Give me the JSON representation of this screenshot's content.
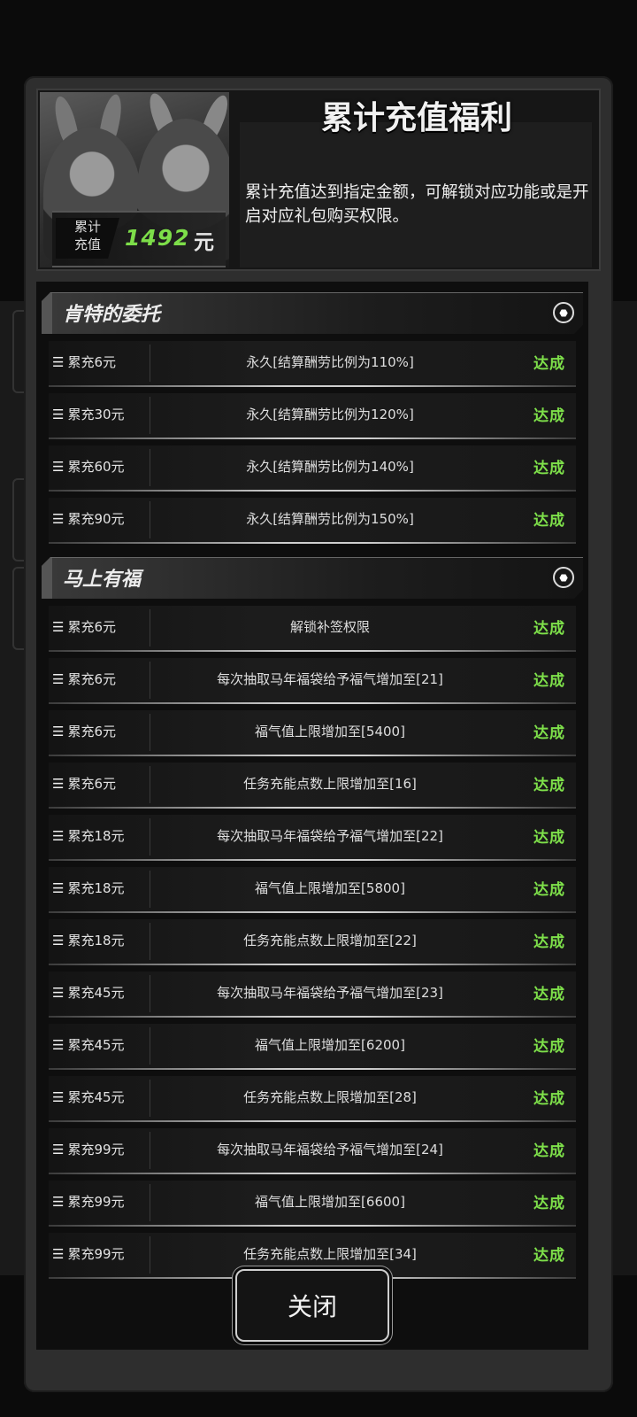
{
  "header": {
    "title": "累计充值福利",
    "description": "累计充值达到指定金额，可解锁对应功能或是开启对应礼包购买权限。",
    "total_label_line1": "累计",
    "total_label_line2": "充值",
    "total_value": "1492",
    "total_unit": "元"
  },
  "sections": [
    {
      "title": "肯特的委托",
      "rows": [
        {
          "req": "累充6元",
          "reward": "永久[结算酬劳比例为110%]",
          "status": "达成"
        },
        {
          "req": "累充30元",
          "reward": "永久[结算酬劳比例为120%]",
          "status": "达成"
        },
        {
          "req": "累充60元",
          "reward": "永久[结算酬劳比例为140%]",
          "status": "达成"
        },
        {
          "req": "累充90元",
          "reward": "永久[结算酬劳比例为150%]",
          "status": "达成"
        }
      ]
    },
    {
      "title": "马上有福",
      "rows": [
        {
          "req": "累充6元",
          "reward": "解锁补签权限",
          "status": "达成"
        },
        {
          "req": "累充6元",
          "reward": "每次抽取马年福袋给予福气增加至[21]",
          "status": "达成"
        },
        {
          "req": "累充6元",
          "reward": "福气值上限增加至[5400]",
          "status": "达成"
        },
        {
          "req": "累充6元",
          "reward": "任务充能点数上限增加至[16]",
          "status": "达成"
        },
        {
          "req": "累充18元",
          "reward": "每次抽取马年福袋给予福气增加至[22]",
          "status": "达成"
        },
        {
          "req": "累充18元",
          "reward": "福气值上限增加至[5800]",
          "status": "达成"
        },
        {
          "req": "累充18元",
          "reward": "任务充能点数上限增加至[22]",
          "status": "达成"
        },
        {
          "req": "累充45元",
          "reward": "每次抽取马年福袋给予福气增加至[23]",
          "status": "达成"
        },
        {
          "req": "累充45元",
          "reward": "福气值上限增加至[6200]",
          "status": "达成"
        },
        {
          "req": "累充45元",
          "reward": "任务充能点数上限增加至[28]",
          "status": "达成"
        },
        {
          "req": "累充99元",
          "reward": "每次抽取马年福袋给予福气增加至[24]",
          "status": "达成"
        },
        {
          "req": "累充99元",
          "reward": "福气值上限增加至[6600]",
          "status": "达成"
        },
        {
          "req": "累充99元",
          "reward": "任务充能点数上限增加至[34]",
          "status": "达成"
        }
      ]
    }
  ],
  "close_label": "关闭",
  "icons": {
    "row_icon": "layers-icon",
    "section_icon": "hexagon-icon"
  },
  "colors": {
    "status_green": "#7ee04a",
    "total_green": "#7dde49"
  }
}
